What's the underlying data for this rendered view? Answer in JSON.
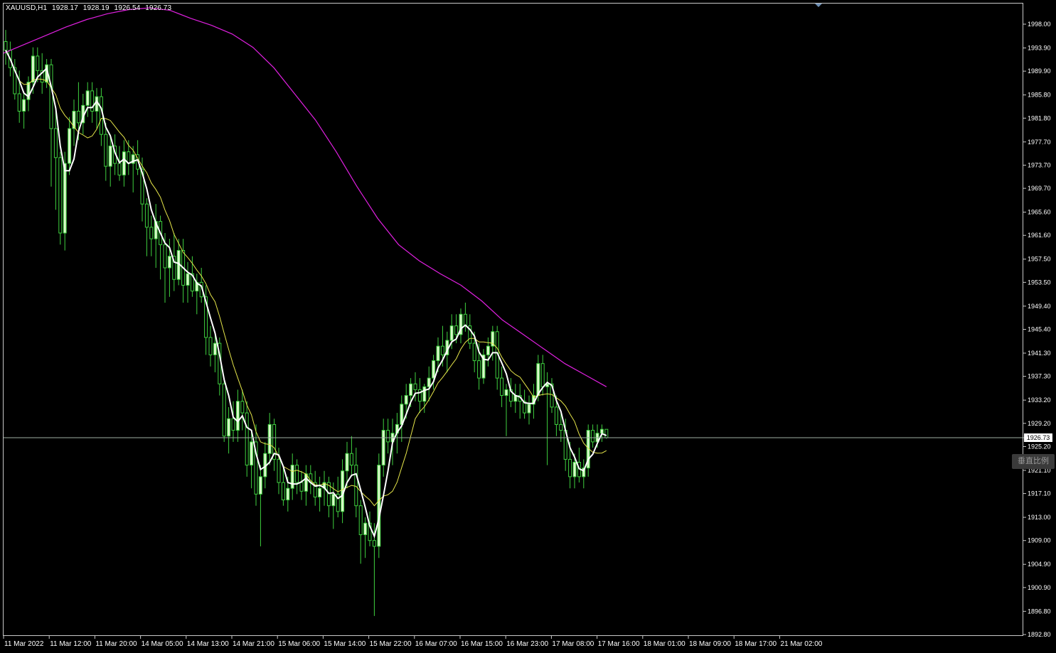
{
  "header": {
    "symbol": "XAUUSD,H1",
    "open": "1928.17",
    "high": "1928.19",
    "low": "1926.54",
    "close": "1926.73"
  },
  "scale_badge": "垂直比例",
  "current_price": "1926.73",
  "colors": {
    "background": "#000000",
    "bull_candle": "#d9f7c9",
    "bear_candle": "#000000",
    "wick": "#3fd13f",
    "ma_fast": "#ffffff",
    "ma_medium": "#e6e64a",
    "ma_slow": "#e020e0",
    "bid_line": "#9fb0a5"
  },
  "chart_data": {
    "type": "candlestick",
    "symbol": "XAUUSD",
    "timeframe": "H1",
    "ylim": [
      1892.8,
      2002.3
    ],
    "price_ticks": [
      "1998.00",
      "1993.90",
      "1989.90",
      "1985.80",
      "1981.80",
      "1977.70",
      "1973.70",
      "1969.70",
      "1965.60",
      "1961.60",
      "1957.50",
      "1953.50",
      "1949.40",
      "1945.40",
      "1941.30",
      "1937.30",
      "1933.20",
      "1929.20",
      "1925.20",
      "1921.10",
      "1917.10",
      "1913.00",
      "1909.00",
      "1904.90",
      "1900.90",
      "1896.80",
      "1892.80"
    ],
    "time_ticks": [
      "11 Mar 2022",
      "11 Mar 12:00",
      "11 Mar 20:00",
      "14 Mar 05:00",
      "14 Mar 13:00",
      "14 Mar 21:00",
      "15 Mar 06:00",
      "15 Mar 14:00",
      "15 Mar 22:00",
      "16 Mar 07:00",
      "16 Mar 15:00",
      "16 Mar 23:00",
      "17 Mar 08:00",
      "17 Mar 16:00",
      "18 Mar 01:00",
      "18 Mar 09:00",
      "18 Mar 17:00",
      "21 Mar 02:00"
    ],
    "current_price": 1926.73,
    "candles": [
      [
        1995.0,
        1997.0,
        1991.0,
        1993.5
      ],
      [
        1993.5,
        1995.0,
        1989.0,
        1990.5
      ],
      [
        1990.5,
        1992.0,
        1985.0,
        1986.0
      ],
      [
        1986.0,
        1990.0,
        1981.0,
        1983.0
      ],
      [
        1983.0,
        1986.0,
        1980.0,
        1985.0
      ],
      [
        1985.0,
        1989.0,
        1983.0,
        1988.0
      ],
      [
        1988.0,
        1994.0,
        1986.0,
        1992.5
      ],
      [
        1992.5,
        1994.0,
        1988.0,
        1990.0
      ],
      [
        1990.0,
        1993.0,
        1986.0,
        1988.0
      ],
      [
        1988.0,
        1992.0,
        1987.0,
        1991.0
      ],
      [
        1991.0,
        1992.0,
        1970.0,
        1980.0
      ],
      [
        1980.0,
        1983.0,
        1966.0,
        1975.0
      ],
      [
        1975.0,
        1976.0,
        1960.0,
        1962.0
      ],
      [
        1962.0,
        1976.0,
        1959.0,
        1974.0
      ],
      [
        1974.0,
        1982.0,
        1972.0,
        1980.0
      ],
      [
        1980.0,
        1985.0,
        1977.0,
        1983.0
      ],
      [
        1983.0,
        1988.0,
        1978.0,
        1981.0
      ],
      [
        1981.0,
        1986.0,
        1979.0,
        1984.0
      ],
      [
        1984.0,
        1988.0,
        1982.0,
        1986.5
      ],
      [
        1986.5,
        1988.0,
        1981.0,
        1983.0
      ],
      [
        1983.0,
        1987.0,
        1980.0,
        1985.5
      ],
      [
        1985.5,
        1987.0,
        1977.0,
        1979.0
      ],
      [
        1979.0,
        1981.0,
        1971.0,
        1973.5
      ],
      [
        1973.5,
        1979.0,
        1970.0,
        1977.0
      ],
      [
        1977.0,
        1979.0,
        1972.0,
        1974.0
      ],
      [
        1974.0,
        1977.0,
        1971.0,
        1972.0
      ],
      [
        1972.0,
        1978.0,
        1970.0,
        1976.0
      ],
      [
        1976.0,
        1978.0,
        1972.0,
        1974.0
      ],
      [
        1974.0,
        1977.0,
        1969.0,
        1975.5
      ],
      [
        1975.5,
        1978.0,
        1972.0,
        1973.0
      ],
      [
        1973.0,
        1975.0,
        1964.0,
        1967.0
      ],
      [
        1967.0,
        1968.0,
        1958.0,
        1963.0
      ],
      [
        1963.0,
        1965.0,
        1958.0,
        1961.0
      ],
      [
        1961.0,
        1967.0,
        1956.0,
        1964.0
      ],
      [
        1964.0,
        1965.0,
        1954.0,
        1960.0
      ],
      [
        1960.0,
        1962.0,
        1950.0,
        1956.0
      ],
      [
        1956.0,
        1961.0,
        1951.0,
        1958.0
      ],
      [
        1958.0,
        1962.0,
        1952.0,
        1954.0
      ],
      [
        1954.0,
        1961.0,
        1953.0,
        1959.0
      ],
      [
        1959.0,
        1961.0,
        1950.0,
        1953.0
      ],
      [
        1953.0,
        1957.0,
        1950.0,
        1955.0
      ],
      [
        1955.0,
        1958.0,
        1951.0,
        1952.0
      ],
      [
        1952.0,
        1955.0,
        1948.0,
        1953.5
      ],
      [
        1953.5,
        1956.0,
        1950.0,
        1951.0
      ],
      [
        1951.0,
        1953.0,
        1941.0,
        1944.0
      ],
      [
        1944.0,
        1946.0,
        1939.0,
        1941.0
      ],
      [
        1941.0,
        1945.0,
        1938.0,
        1943.0
      ],
      [
        1943.0,
        1944.0,
        1934.0,
        1936.0
      ],
      [
        1936.0,
        1937.0,
        1926.0,
        1927.0
      ],
      [
        1927.0,
        1932.0,
        1924.0,
        1930.0
      ],
      [
        1930.0,
        1933.0,
        1926.0,
        1928.0
      ],
      [
        1928.0,
        1935.0,
        1926.0,
        1933.0
      ],
      [
        1933.0,
        1935.0,
        1928.0,
        1931.0
      ],
      [
        1931.0,
        1933.0,
        1920.0,
        1922.0
      ],
      [
        1922.0,
        1928.0,
        1918.0,
        1926.0
      ],
      [
        1926.0,
        1929.0,
        1915.0,
        1917.0
      ],
      [
        1917.0,
        1922.0,
        1908.0,
        1920.0
      ],
      [
        1920.0,
        1926.0,
        1918.0,
        1924.0
      ],
      [
        1924.0,
        1931.0,
        1922.0,
        1929.0
      ],
      [
        1929.0,
        1930.0,
        1921.0,
        1923.0
      ],
      [
        1923.0,
        1925.0,
        1917.0,
        1919.0
      ],
      [
        1919.0,
        1922.0,
        1915.0,
        1916.0
      ],
      [
        1916.0,
        1920.0,
        1914.0,
        1918.0
      ],
      [
        1918.0,
        1924.0,
        1916.0,
        1922.0
      ],
      [
        1922.0,
        1923.0,
        1917.0,
        1919.0
      ],
      [
        1919.0,
        1921.0,
        1916.0,
        1917.5
      ],
      [
        1917.5,
        1922.0,
        1915.0,
        1920.5
      ],
      [
        1920.5,
        1922.0,
        1917.0,
        1919.0
      ],
      [
        1919.0,
        1921.0,
        1915.0,
        1916.5
      ],
      [
        1916.5,
        1920.0,
        1914.0,
        1918.0
      ],
      [
        1918.0,
        1921.0,
        1915.0,
        1919.0
      ],
      [
        1919.0,
        1920.0,
        1913.0,
        1915.0
      ],
      [
        1915.0,
        1919.0,
        1911.0,
        1917.0
      ],
      [
        1917.0,
        1920.0,
        1913.0,
        1914.0
      ],
      [
        1914.0,
        1923.0,
        1912.0,
        1921.0
      ],
      [
        1921.0,
        1926.0,
        1918.0,
        1924.0
      ],
      [
        1924.0,
        1927.0,
        1920.0,
        1922.0
      ],
      [
        1922.0,
        1925.0,
        1913.0,
        1915.0
      ],
      [
        1915.0,
        1916.0,
        1905.0,
        1910.0
      ],
      [
        1910.0,
        1913.0,
        1906.0,
        1912.0
      ],
      [
        1912.0,
        1914.0,
        1908.0,
        1909.0
      ],
      [
        1909.0,
        1912.0,
        1896.0,
        1908.0
      ],
      [
        1908.0,
        1924.0,
        1906.0,
        1922.0
      ],
      [
        1922.0,
        1930.0,
        1920.0,
        1928.0
      ],
      [
        1928.0,
        1930.0,
        1924.0,
        1926.0
      ],
      [
        1926.0,
        1930.0,
        1922.0,
        1927.5
      ],
      [
        1927.5,
        1931.0,
        1924.0,
        1929.0
      ],
      [
        1929.0,
        1934.0,
        1926.0,
        1932.5
      ],
      [
        1932.5,
        1936.0,
        1930.0,
        1934.0
      ],
      [
        1934.0,
        1937.0,
        1932.0,
        1936.0
      ],
      [
        1936.0,
        1938.0,
        1933.0,
        1935.0
      ],
      [
        1935.0,
        1937.0,
        1931.0,
        1933.0
      ],
      [
        1933.0,
        1936.0,
        1931.0,
        1935.5
      ],
      [
        1935.5,
        1939.0,
        1933.0,
        1937.0
      ],
      [
        1937.0,
        1941.0,
        1935.0,
        1940.0
      ],
      [
        1940.0,
        1944.0,
        1938.0,
        1942.5
      ],
      [
        1942.5,
        1946.0,
        1939.0,
        1941.0
      ],
      [
        1941.0,
        1945.0,
        1938.0,
        1943.5
      ],
      [
        1943.5,
        1948.0,
        1942.0,
        1946.0
      ],
      [
        1946.0,
        1948.0,
        1943.0,
        1944.5
      ],
      [
        1944.5,
        1949.0,
        1943.0,
        1948.0
      ],
      [
        1948.0,
        1950.0,
        1945.0,
        1946.0
      ],
      [
        1946.0,
        1948.0,
        1942.0,
        1943.0
      ],
      [
        1943.0,
        1945.0,
        1938.0,
        1940.0
      ],
      [
        1940.0,
        1943.0,
        1935.0,
        1937.0
      ],
      [
        1937.0,
        1942.0,
        1936.0,
        1941.0
      ],
      [
        1941.0,
        1944.0,
        1939.0,
        1942.5
      ],
      [
        1942.5,
        1946.0,
        1940.0,
        1945.0
      ],
      [
        1945.0,
        1946.0,
        1935.0,
        1937.0
      ],
      [
        1937.0,
        1939.0,
        1932.0,
        1934.0
      ],
      [
        1934.0,
        1936.0,
        1927.0,
        1935.0
      ],
      [
        1935.0,
        1937.0,
        1932.0,
        1933.0
      ],
      [
        1933.0,
        1936.0,
        1931.0,
        1934.0
      ],
      [
        1934.0,
        1936.0,
        1930.0,
        1933.0
      ],
      [
        1933.0,
        1935.0,
        1930.0,
        1931.0
      ],
      [
        1931.0,
        1934.0,
        1929.0,
        1932.5
      ],
      [
        1932.5,
        1936.0,
        1930.0,
        1934.0
      ],
      [
        1934.0,
        1941.0,
        1933.0,
        1939.5
      ],
      [
        1939.5,
        1941.0,
        1934.0,
        1935.5
      ],
      [
        1935.5,
        1938.0,
        1922.0,
        1936.0
      ],
      [
        1936.0,
        1937.0,
        1931.0,
        1932.0
      ],
      [
        1932.0,
        1934.0,
        1927.0,
        1929.0
      ],
      [
        1929.0,
        1931.0,
        1926.0,
        1928.0
      ],
      [
        1928.0,
        1930.0,
        1921.0,
        1923.0
      ],
      [
        1923.0,
        1926.0,
        1918.0,
        1920.0
      ],
      [
        1920.0,
        1924.0,
        1918.0,
        1922.5
      ],
      [
        1922.5,
        1925.0,
        1919.0,
        1920.0
      ],
      [
        1920.0,
        1923.0,
        1918.0,
        1921.5
      ],
      [
        1921.5,
        1929.0,
        1920.0,
        1928.0
      ],
      [
        1928.0,
        1929.0,
        1925.0,
        1926.0
      ],
      [
        1926.0,
        1929.0,
        1925.0,
        1927.5
      ],
      [
        1927.5,
        1929.0,
        1926.0,
        1928.17
      ],
      [
        1928.17,
        1928.19,
        1926.54,
        1926.73
      ]
    ],
    "series": [
      {
        "name": "",
        "color": "ma_fast",
        "values": []
      },
      {
        "name": "",
        "color": "ma_medium",
        "values": []
      },
      {
        "name": "",
        "color": "ma_slow",
        "values": [
          1993.0,
          1994.5,
          1996.0,
          1997.5,
          1998.8,
          1999.8,
          2000.5,
          2000.8,
          2000.4,
          1999.0,
          1997.8,
          1996.3,
          1994.0,
          1990.5,
          1986.0,
          1981.5,
          1976.0,
          1970.0,
          1964.5,
          1960.0,
          1957.2,
          1955.0,
          1953.0,
          1950.3,
          1947.0,
          1944.5,
          1942.0,
          1939.5,
          1937.5,
          1935.5
        ]
      }
    ]
  }
}
